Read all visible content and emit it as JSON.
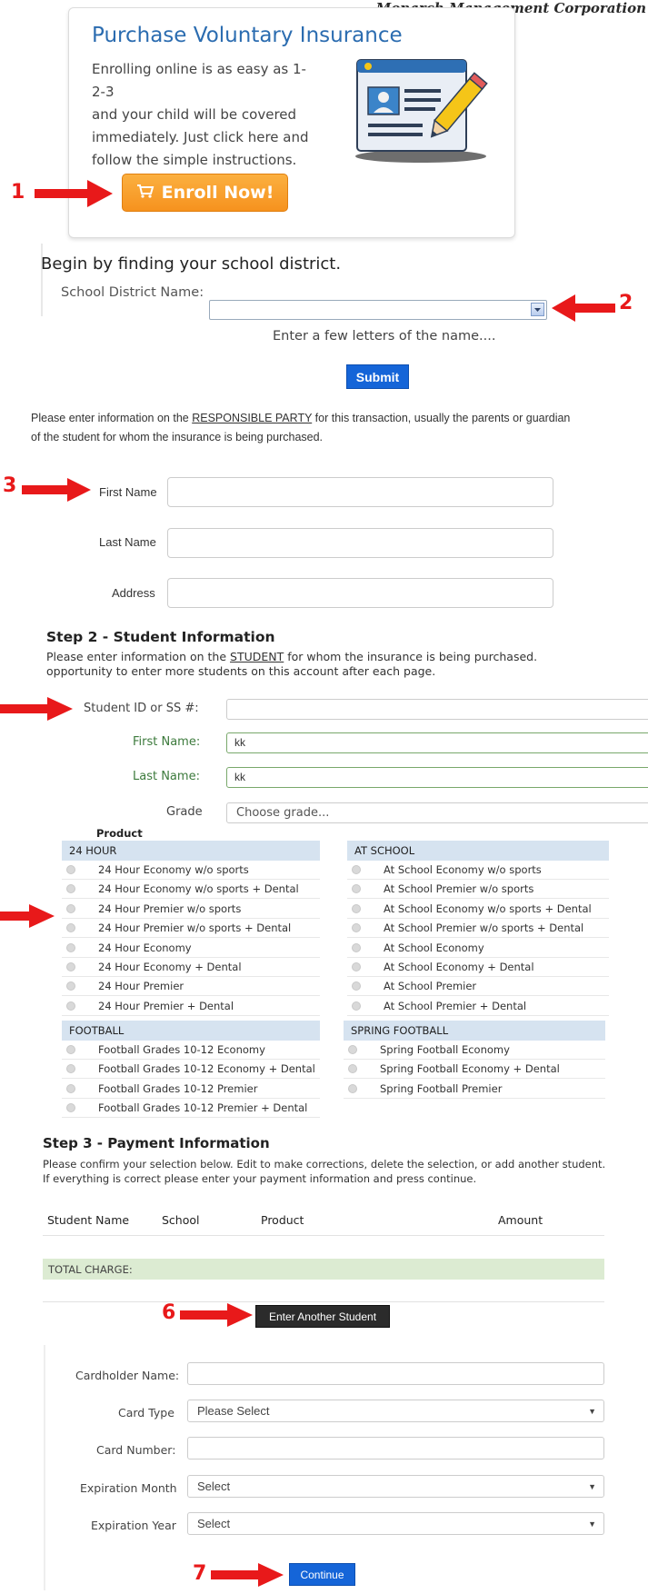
{
  "brand": "Monarch Management Corporation",
  "promo": {
    "title": "Purchase Voluntary Insurance",
    "lines": [
      "Enrolling online is as easy as 1-2-3",
      "and your child will be covered",
      "immediately. Just click here and",
      "follow the simple instructions."
    ],
    "enroll_label": "Enroll Now!"
  },
  "annotations": [
    "1",
    "2",
    "3",
    "6",
    "7"
  ],
  "district": {
    "heading": "Begin by finding your school district.",
    "label": "School District Name:",
    "value": "",
    "hint": "Enter a few letters of the name....",
    "submit_label": "Submit"
  },
  "responsible": {
    "intro_before": "Please enter information on the ",
    "intro_link": "RESPONSIBLE PARTY",
    "intro_after": " for this transaction, usually the parents or guardian",
    "intro_line2": "of the student for whom the insurance is being purchased.",
    "first_name_label": "First Name",
    "last_name_label": "Last Name",
    "address_label": "Address"
  },
  "student": {
    "title": "Step 2 - Student Information",
    "intro_before": "Please enter information on the ",
    "intro_link": "STUDENT",
    "intro_after": " for whom the insurance is being purchased.",
    "intro_line2": "opportunity to enter more students on this account after each page.",
    "id_label": "Student ID or SS #:",
    "id_value": "",
    "first_label": "First Name:",
    "first_value": "kk",
    "last_label": "Last Name:",
    "last_value": "kk",
    "grade_label": "Grade",
    "grade_value": "Choose grade..."
  },
  "products": {
    "header": "Product",
    "groups": [
      {
        "name": "24 HOUR",
        "items": [
          "24 Hour Economy w/o sports",
          "24 Hour Economy w/o sports + Dental",
          "24 Hour Premier w/o sports",
          "24 Hour Premier w/o sports + Dental",
          "24 Hour Economy",
          "24 Hour Economy + Dental",
          "24 Hour Premier",
          "24 Hour Premier + Dental"
        ]
      },
      {
        "name": "AT SCHOOL",
        "items": [
          "At School Economy w/o sports",
          "At School Premier w/o sports",
          "At School Economy w/o sports + Dental",
          "At School Premier w/o sports + Dental",
          "At School Economy",
          "At School Economy + Dental",
          "At School Premier",
          "At School Premier + Dental"
        ]
      },
      {
        "name": "FOOTBALL",
        "items": [
          "Football Grades 10-12 Economy",
          "Football Grades 10-12 Economy + Dental",
          "Football Grades 10-12 Premier",
          "Football Grades 10-12 Premier + Dental"
        ]
      },
      {
        "name": "SPRING FOOTBALL",
        "items": [
          "Spring Football Economy",
          "Spring Football Economy + Dental",
          "Spring Football Premier"
        ]
      }
    ]
  },
  "payment": {
    "title": "Step 3 - Payment Information",
    "intro_line1": "Please confirm your selection below. Edit to make corrections, delete the selection, or add another student.",
    "intro_line2": "If everything is correct please enter your payment information and press continue.",
    "columns": [
      "Student Name",
      "School",
      "Product",
      "Amount"
    ],
    "total_label": "TOTAL CHARGE:",
    "another_label": "Enter Another Student",
    "cardholder_label": "Cardholder Name:",
    "card_type_label": "Card Type",
    "card_type_value": "Please Select",
    "card_number_label": "Card Number:",
    "exp_month_label": "Expiration Month",
    "exp_month_value": "Select",
    "exp_year_label": "Expiration Year",
    "exp_year_value": "Select",
    "continue_label": "Continue"
  },
  "colors": {
    "accent": "#1565d8",
    "arrow": "#e8191a",
    "enroll": "#f6921e",
    "total_bg": "#dcebd2"
  }
}
